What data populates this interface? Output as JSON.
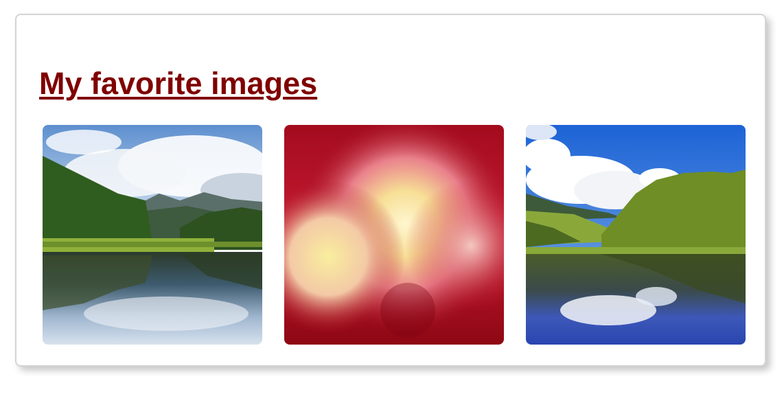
{
  "page": {
    "title": "My favorite images"
  },
  "gallery": {
    "images": [
      {
        "subject": "mountain lake with forest and clouds reflected in water"
      },
      {
        "subject": "abstract red and yellow blurred bokeh"
      },
      {
        "subject": "forest lake with blue sky and white clouds reflected"
      }
    ]
  },
  "colors": {
    "title": "#800000",
    "card_border": "#d4d4d4",
    "background": "#ffffff"
  }
}
